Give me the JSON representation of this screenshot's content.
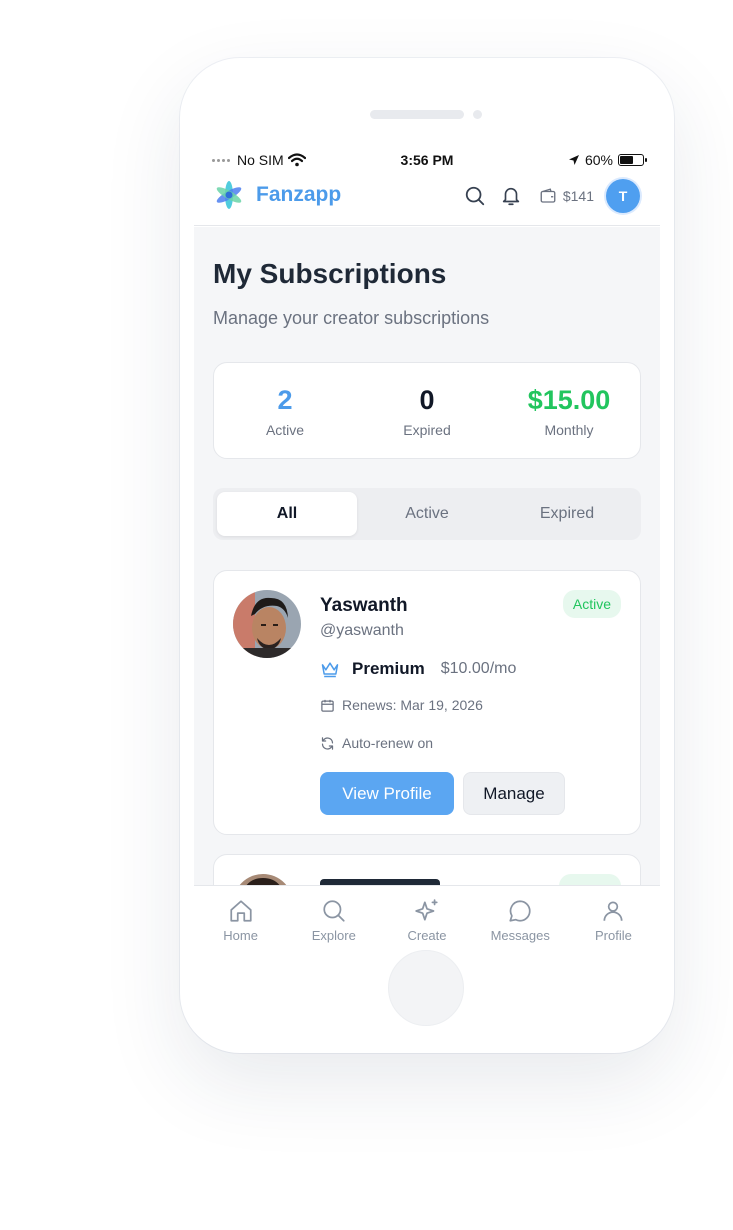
{
  "status_bar": {
    "carrier": "No SIM",
    "time": "3:56 PM",
    "battery": "60%",
    "battery_level": 0.6
  },
  "app": {
    "name": "Fanzapp",
    "wallet_balance": "$141",
    "avatar_initial": "T"
  },
  "page": {
    "title": "My Subscriptions",
    "subtitle": "Manage your creator subscriptions"
  },
  "stats": [
    {
      "value": "2",
      "label": "Active",
      "color": "#4c9bea"
    },
    {
      "value": "0",
      "label": "Expired",
      "color": "#111827"
    },
    {
      "value": "$15.00",
      "label": "Monthly",
      "color": "#22c55e"
    }
  ],
  "tabs": [
    "All",
    "Active",
    "Expired"
  ],
  "subscriptions": [
    {
      "name": "Yaswanth",
      "handle": "@yaswanth",
      "status": "Active",
      "tier": "Premium",
      "price": "$10.00/mo",
      "renews": "Renews: Mar 19, 2026",
      "auto_renew": "Auto-renew on",
      "primary_action": "View Profile",
      "secondary_action": "Manage"
    }
  ],
  "bottom_nav": [
    "Home",
    "Explore",
    "Create",
    "Messages",
    "Profile"
  ],
  "colors": {
    "accent": "#4c9bea",
    "success": "#22c55e",
    "text": "#111827",
    "muted": "#6b7280"
  }
}
